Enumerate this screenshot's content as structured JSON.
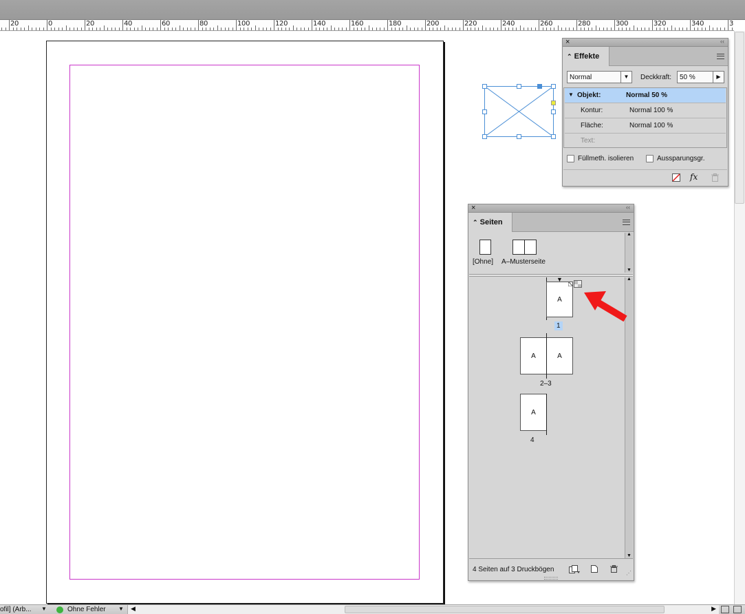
{
  "ruler": {
    "labels": [
      "20",
      "0",
      "20",
      "40",
      "60",
      "80",
      "100",
      "120",
      "140",
      "160",
      "180",
      "200",
      "220",
      "240",
      "260",
      "280",
      "300",
      "320",
      "340",
      "3"
    ]
  },
  "effects_panel": {
    "close_glyph": "×",
    "collapse_glyph": "‹‹",
    "tab_arrow": "⌃",
    "tab_label": "Effekte",
    "blend_mode": "Normal",
    "opacity_label": "Deckkraft:",
    "opacity_value": "50 %",
    "rows": [
      {
        "label": "Objekt:",
        "value": "Normal 50 %"
      },
      {
        "label": "Kontur:",
        "value": "Normal 100 %"
      },
      {
        "label": "Fläche:",
        "value": "Normal 100 %"
      },
      {
        "label": "Text:",
        "value": ""
      }
    ],
    "checkbox_isolate": "Füllmeth. isolieren",
    "checkbox_knockout": "Aussparungsgr.",
    "fx_label": "fx"
  },
  "pages_panel": {
    "close_glyph": "×",
    "collapse_glyph": "‹‹",
    "tab_arrow": "⌃",
    "tab_label": "Seiten",
    "masters": [
      {
        "label": "[Ohne]"
      },
      {
        "label": "A–Musterseite"
      }
    ],
    "spreads": [
      {
        "label": "1",
        "pages": [
          "A"
        ]
      },
      {
        "label": "2–3",
        "pages": [
          "A",
          "A"
        ]
      },
      {
        "label": "4",
        "pages": [
          "A"
        ]
      }
    ],
    "status": "4 Seiten auf 3 Druckbögen"
  },
  "statusbar": {
    "profile": "ofil] (Arb...",
    "preflight": "Ohne Fehler"
  },
  "colors": {
    "margin": "#c934c9",
    "frame": "#4b8fd6",
    "selection": "#b4d4f7",
    "arrow": "#f01919",
    "preflight_ok": "#3fb33f"
  }
}
